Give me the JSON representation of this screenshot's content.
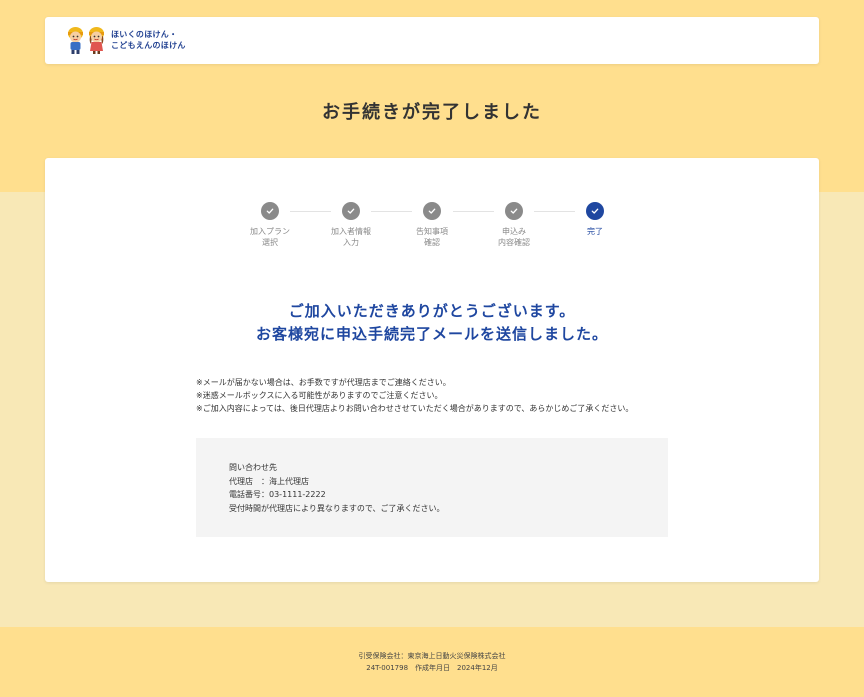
{
  "header": {
    "logo_line1": "ほいくのほけん・",
    "logo_line2": "こどもえんのほけん"
  },
  "page": {
    "title": "お手続きが完了しました"
  },
  "stepper": {
    "steps": [
      {
        "line1": "加入プラン",
        "line2": "選択",
        "state": "done"
      },
      {
        "line1": "加入者情報",
        "line2": "入力",
        "state": "done"
      },
      {
        "line1": "告知事項",
        "line2": "確認",
        "state": "done"
      },
      {
        "line1": "申込み",
        "line2": "内容確認",
        "state": "done"
      },
      {
        "line1": "完了",
        "line2": "",
        "state": "current"
      }
    ]
  },
  "message": {
    "line1": "ご加入いただきありがとうございます。",
    "line2": "お客様宛に申込手続完了メールを送信しました。"
  },
  "notes": [
    "※メールが届かない場合は、お手数ですが代理店までご連絡ください。",
    "※迷惑メールボックスに入る可能性がありますのでご注意ください。",
    "※ご加入内容によっては、後日代理店よりお問い合わせさせていただく場合がありますので、あらかじめご了承ください。"
  ],
  "contact": {
    "heading": "問い合わせ先",
    "agency": "代理店　：海上代理店",
    "phone": "電話番号：03-1111-2222",
    "note": "受付時間が代理店により異なりますので、ご了承ください。"
  },
  "footer": {
    "line1": "引受保険会社：東京海上日動火災保険株式会社",
    "line2": "24T-001798　作成年月日　2024年12月"
  },
  "colors": {
    "accent": "#1f47a0",
    "band": "#ffdf8e",
    "background": "#f8e8b6",
    "step_done": "#8a8a8a"
  },
  "icons": {
    "step_done": "check-icon",
    "step_current": "check-icon"
  }
}
